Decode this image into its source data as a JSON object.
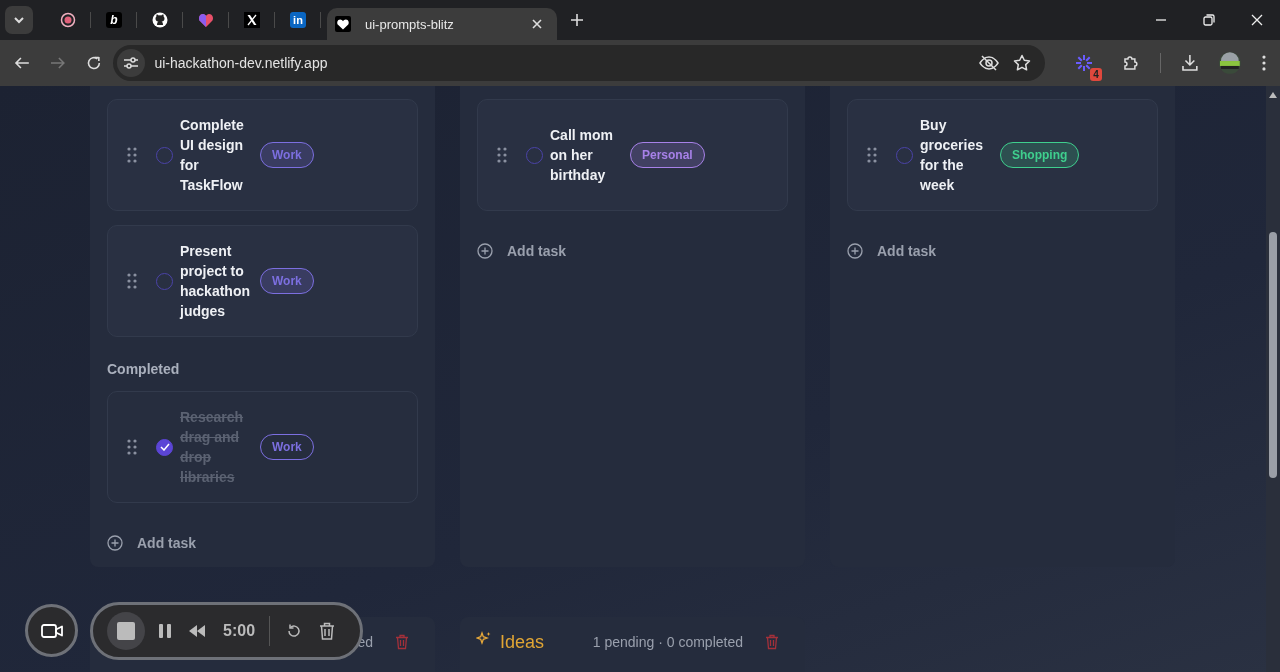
{
  "browser": {
    "tabs": [
      {
        "kind": "record",
        "selected": false
      },
      {
        "kind": "letter",
        "glyph": "b",
        "selected": false
      },
      {
        "kind": "github",
        "selected": false
      },
      {
        "kind": "heart",
        "selected": false
      },
      {
        "kind": "x",
        "selected": false
      },
      {
        "kind": "letter-blue",
        "glyph": "in",
        "selected": false
      },
      {
        "kind": "heart-white",
        "title": "ui-prompts-blitz",
        "selected": true
      }
    ],
    "address": "ui-hackathon-dev.netlify.app",
    "extension_badge": "4"
  },
  "board": {
    "columns": [
      {
        "tasks": [
          {
            "title": "Complete UI design for TaskFlow",
            "tag": "Work",
            "color": "#7c6fe0",
            "done": false
          },
          {
            "title": "Present project to hackathon judges",
            "tag": "Work",
            "color": "#7c6fe0",
            "done": false
          }
        ],
        "completed_heading": "Completed",
        "completed": [
          {
            "title": "Research drag and drop libraries",
            "tag": "Work",
            "color": "#7c6fe0",
            "done": true
          }
        ],
        "add_label": "Add task"
      },
      {
        "tasks": [
          {
            "title": "Call mom on her birthday",
            "tag": "Personal",
            "color": "#a781e8",
            "done": false
          }
        ],
        "add_label": "Add task"
      },
      {
        "tasks": [
          {
            "title": "Buy groceries for the week",
            "tag": "Shopping",
            "color": "#3fcf8e",
            "done": false
          }
        ],
        "add_label": "Add task"
      }
    ],
    "lists": [
      {
        "summary": "ed"
      },
      {
        "title": "Ideas",
        "summary": "1 pending · 0 completed"
      }
    ]
  },
  "recorder": {
    "time": "5:00"
  }
}
